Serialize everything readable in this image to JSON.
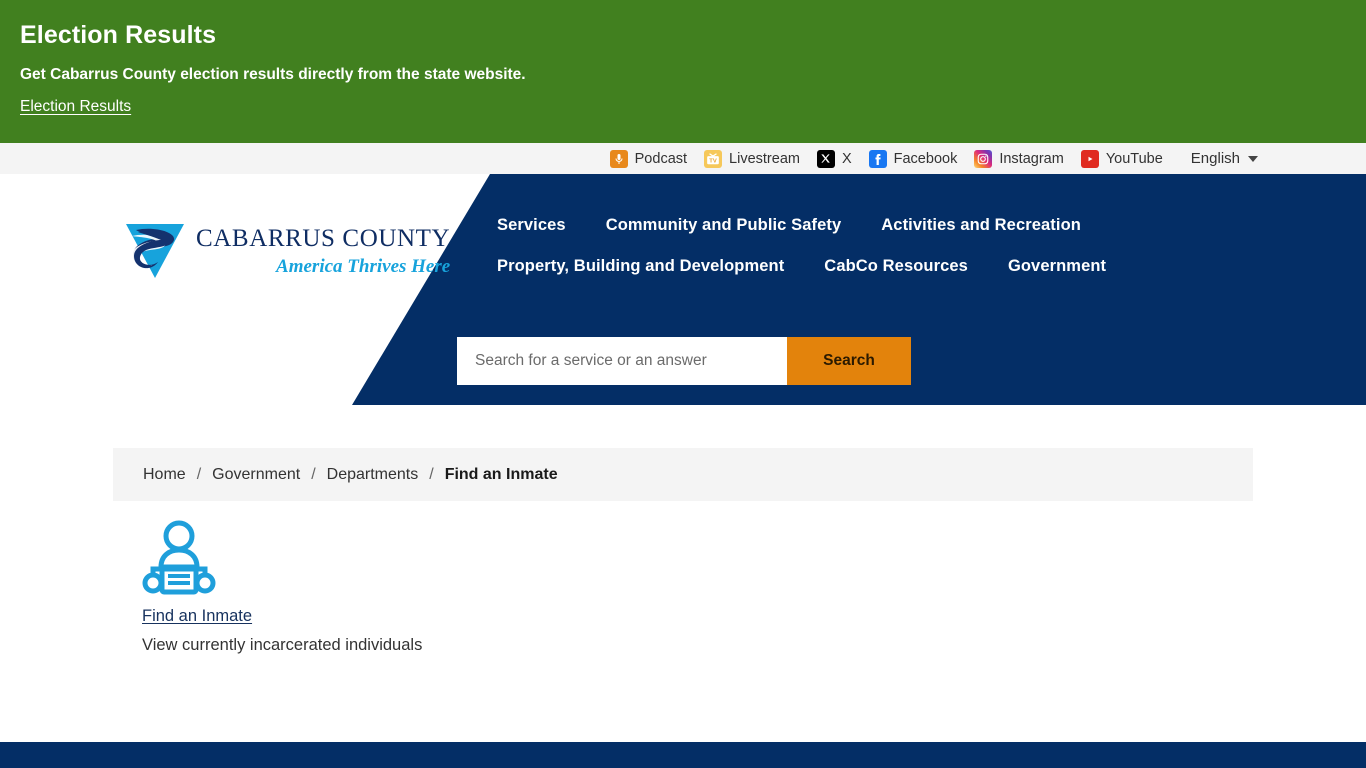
{
  "alert": {
    "title": "Election Results",
    "description": "Get Cabarrus County election results directly from the state website.",
    "link_label": "Election Results",
    "background": "#41801F"
  },
  "social_bar": {
    "items": [
      {
        "label": "Podcast",
        "icon": "podcast-icon",
        "glyph": "♁",
        "color": "#E8881B"
      },
      {
        "label": "Livestream",
        "icon": "livestream-icon",
        "glyph": "TV",
        "color": "#F6C85A"
      },
      {
        "label": "X",
        "icon": "x-icon",
        "glyph": "✕",
        "color": "#000000"
      },
      {
        "label": "Facebook",
        "icon": "facebook-icon",
        "glyph": "f",
        "color": "#1877F2"
      },
      {
        "label": "Instagram",
        "icon": "instagram-icon",
        "glyph": "◎",
        "color": "#DD2A7B"
      },
      {
        "label": "YouTube",
        "icon": "youtube-icon",
        "glyph": "▶",
        "color": "#E02B20"
      }
    ],
    "language": "English"
  },
  "header": {
    "logo": {
      "name_line1": "CABARRUS COUNTY",
      "tagline": "America Thrives Here",
      "brand_navy": "#0F2D63",
      "brand_cyan": "#17A3DC"
    },
    "background": "#042E66",
    "nav_rows": [
      [
        "Services",
        "Community and Public Safety",
        "Activities and Recreation"
      ],
      [
        "Property, Building and Development",
        "CabCo Resources",
        "Government"
      ]
    ],
    "search": {
      "placeholder": "Search for a service or an answer",
      "value": "",
      "button_label": "Search",
      "button_color": "#E3830C"
    }
  },
  "breadcrumb": {
    "items": [
      "Home",
      "Government",
      "Departments"
    ],
    "current": "Find an Inmate",
    "separator": "/"
  },
  "main": {
    "service": {
      "icon": "inmate-icon",
      "link_label": "Find an Inmate",
      "description": "View currently incarcerated individuals",
      "icon_color": "#1F9FDB"
    }
  },
  "footer": {
    "background": "#042E66"
  }
}
